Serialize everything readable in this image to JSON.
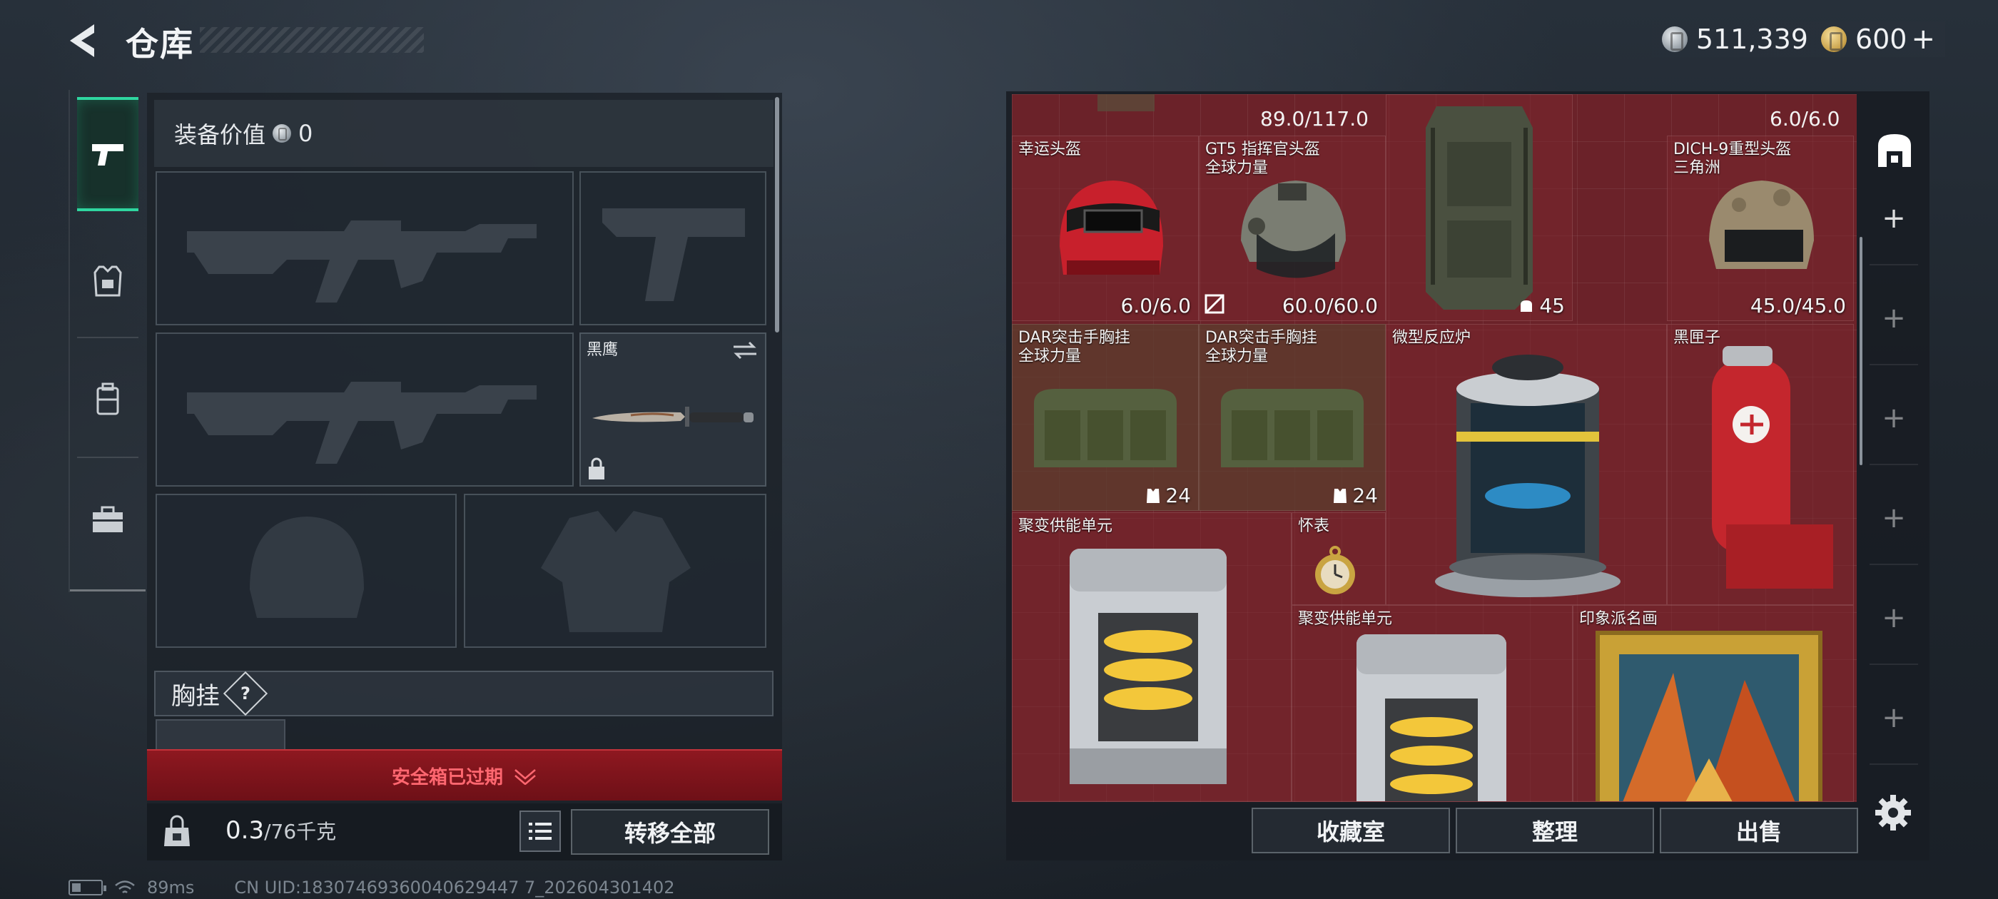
{
  "header": {
    "title": "仓库"
  },
  "currency": {
    "coins": "511,339",
    "premium": "600",
    "premium_plus": "+"
  },
  "equipment": {
    "value_label": "装备价值",
    "value": "0",
    "melee_name": "黑鹰",
    "chest_rig_label": "胸挂",
    "chest_rig_help": "?",
    "safebox_text": "安全箱已过期",
    "weight_current": "0.3",
    "weight_capacity": "/76千克",
    "transfer_all_label": "转移全部"
  },
  "storage": {
    "top_stats": [
      "89.0/117.0",
      "6.0/6.0"
    ],
    "items": [
      {
        "name": "幸运头盔",
        "tag": "",
        "stat": "6.0/6.0"
      },
      {
        "name": "GT5 指挥官头盔",
        "tag": "全球力量",
        "stat": "60.0/60.0"
      },
      {
        "name": "",
        "tag": "",
        "stat": "45"
      },
      {
        "name": "DICH-9重型头盔",
        "tag": "三角洲",
        "stat": "45.0/45.0"
      },
      {
        "name": "DAR突击手胸挂",
        "tag": "全球力量",
        "stat": "24"
      },
      {
        "name": "DAR突击手胸挂",
        "tag": "全球力量",
        "stat": "24"
      },
      {
        "name": "微型反应炉",
        "tag": "",
        "stat": ""
      },
      {
        "name": "黑匣子",
        "tag": "",
        "stat": ""
      },
      {
        "name": "聚变供能单元",
        "tag": "",
        "stat": ""
      },
      {
        "name": "怀表",
        "tag": "",
        "stat": ""
      },
      {
        "name": "聚变供能单元",
        "tag": "",
        "stat": ""
      },
      {
        "name": "印象派名画",
        "tag": "",
        "stat": ""
      }
    ],
    "buttons": {
      "collection": "收藏室",
      "sort": "整理",
      "sell": "出售"
    },
    "add_slot": "+"
  },
  "status": {
    "ping": "89ms",
    "uid": "CN UID:18307469360040629447 7_202604301402"
  },
  "colors": {
    "accent": "#2fd6a0",
    "grid_bg": "#6b2229",
    "alert_red": "#8e1820",
    "alert_text": "#ff6770"
  }
}
